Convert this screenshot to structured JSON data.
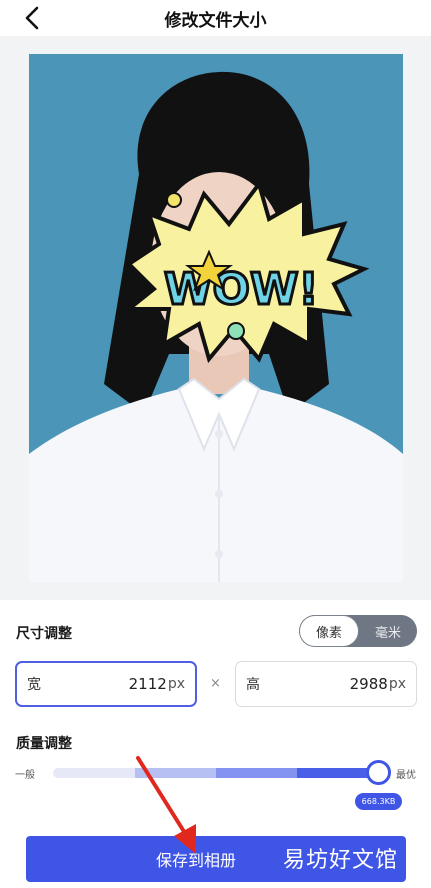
{
  "header": {
    "title": "修改文件大小"
  },
  "size_section": {
    "label": "尺寸调整",
    "unit_toggle": {
      "options": [
        "像素",
        "毫米"
      ],
      "selected": "像素"
    },
    "width": {
      "label": "宽",
      "value": "2112",
      "unit": "px"
    },
    "separator": "×",
    "height": {
      "label": "高",
      "value": "2988",
      "unit": "px"
    }
  },
  "quality_section": {
    "label": "质量调整",
    "min_label": "一般",
    "max_label": "最优",
    "level": 1.0,
    "file_size": "668.3KB"
  },
  "actions": {
    "save_label": "保存到相册"
  },
  "watermark": {
    "text": "易坊好文馆"
  },
  "colors": {
    "accent": "#3f55e6",
    "photo_background": "#4a95b8"
  }
}
